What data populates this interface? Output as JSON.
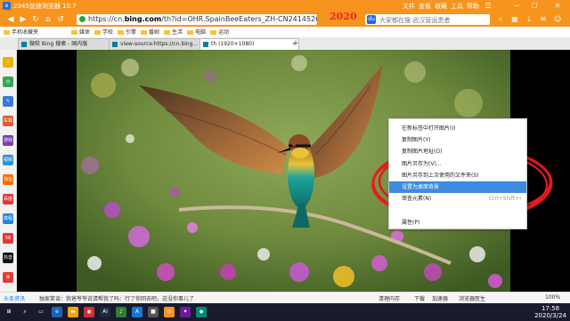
{
  "window": {
    "title": "2345加速浏览器 10.7",
    "menus": [
      "文件",
      "查看",
      "收藏",
      "工具",
      "帮助"
    ]
  },
  "navbar": {
    "url_prefix": "https://cn.",
    "url_domain": "bing.com",
    "url_rest": "/th?id=OHR.SpainBeeEaters_ZH-CN2414526119_1920x10",
    "banner_year": "2020",
    "search_placeholder": "大家都在搜:武汉营运患者"
  },
  "bookmarks": [
    "手机收藏夹",
    "媒体",
    "学校",
    "引擎",
    "番剧",
    "生活",
    "电脑",
    "运动"
  ],
  "tabs": [
    {
      "label": "微软 Bing 搜索 - 国内版"
    },
    {
      "label": "view-source:https://cn.bing..."
    },
    {
      "label": "th (1920×1080)"
    }
  ],
  "sidebar": [
    {
      "label": "☆",
      "color": "#f1b000"
    },
    {
      "label": "◷",
      "color": "#3aa655"
    },
    {
      "label": "✎",
      "color": "#3a7bd5"
    },
    {
      "label": "车载",
      "color": "#e5582c"
    },
    {
      "label": "游戏",
      "color": "#7b3fb6"
    },
    {
      "label": "视频",
      "color": "#2a93d5"
    },
    {
      "label": "淘宝",
      "color": "#ff6a00"
    },
    {
      "label": "百度",
      "color": "#e53935"
    },
    {
      "label": "携程",
      "color": "#1e88e5"
    },
    {
      "label": "58",
      "color": "#e53935"
    },
    {
      "label": "抖音",
      "color": "#111111"
    },
    {
      "label": "✿",
      "color": "#e53935"
    }
  ],
  "context_menu": [
    {
      "label": "在新标签中打开图片(I)",
      "shortcut": "",
      "highlight": false
    },
    {
      "label": "复制图片(Y)",
      "shortcut": "",
      "highlight": false
    },
    {
      "label": "复制图片地址(O)",
      "shortcut": "",
      "highlight": false
    },
    {
      "label": "图片另存为(V)...",
      "shortcut": "",
      "highlight": false
    },
    {
      "label": "图片另存到上次使用的文件夹(S)",
      "shortcut": "",
      "highlight": false
    },
    {
      "label": "设置为桌面背景",
      "shortcut": "",
      "highlight": true
    },
    {
      "label": "审查元素(N)",
      "shortcut": "Ctrl+Shift+I",
      "highlight": false
    },
    {
      "label": "",
      "shortcut": "",
      "highlight": false
    },
    {
      "label": "属性(P)",
      "shortcut": "",
      "highlight": false
    }
  ],
  "statusbar": {
    "news_label": "头条资讯",
    "ticker": "独家笑谈：我爸爷爷说请帮我了吗：行了你回去吧，这没你事儿了",
    "cleanup": "清理内存",
    "download": "下载",
    "accelerate": "加速器",
    "protection": "浏览器医生",
    "zoom": "100%"
  },
  "taskbar": {
    "apps": [
      {
        "label": "⊞",
        "color": "#1a1a2e"
      },
      {
        "label": "⌕",
        "color": "#1a1a2e"
      },
      {
        "label": "▭",
        "color": "#1a1a2e"
      },
      {
        "label": "e",
        "color": "#1565c0"
      },
      {
        "label": "▬",
        "color": "#f7a600"
      },
      {
        "label": "◉",
        "color": "#d32f2f"
      },
      {
        "label": "Ai",
        "color": "#1b2b3b"
      },
      {
        "label": "♪",
        "color": "#2e7d32"
      },
      {
        "label": "A",
        "color": "#1976d2"
      },
      {
        "label": "■",
        "color": "#555555"
      },
      {
        "label": "◎",
        "color": "#f7941d"
      },
      {
        "label": "✦",
        "color": "#6a1b9a"
      },
      {
        "label": "◆",
        "color": "#00897b"
      }
    ],
    "time": "17:58",
    "date": "2020/3/24"
  }
}
